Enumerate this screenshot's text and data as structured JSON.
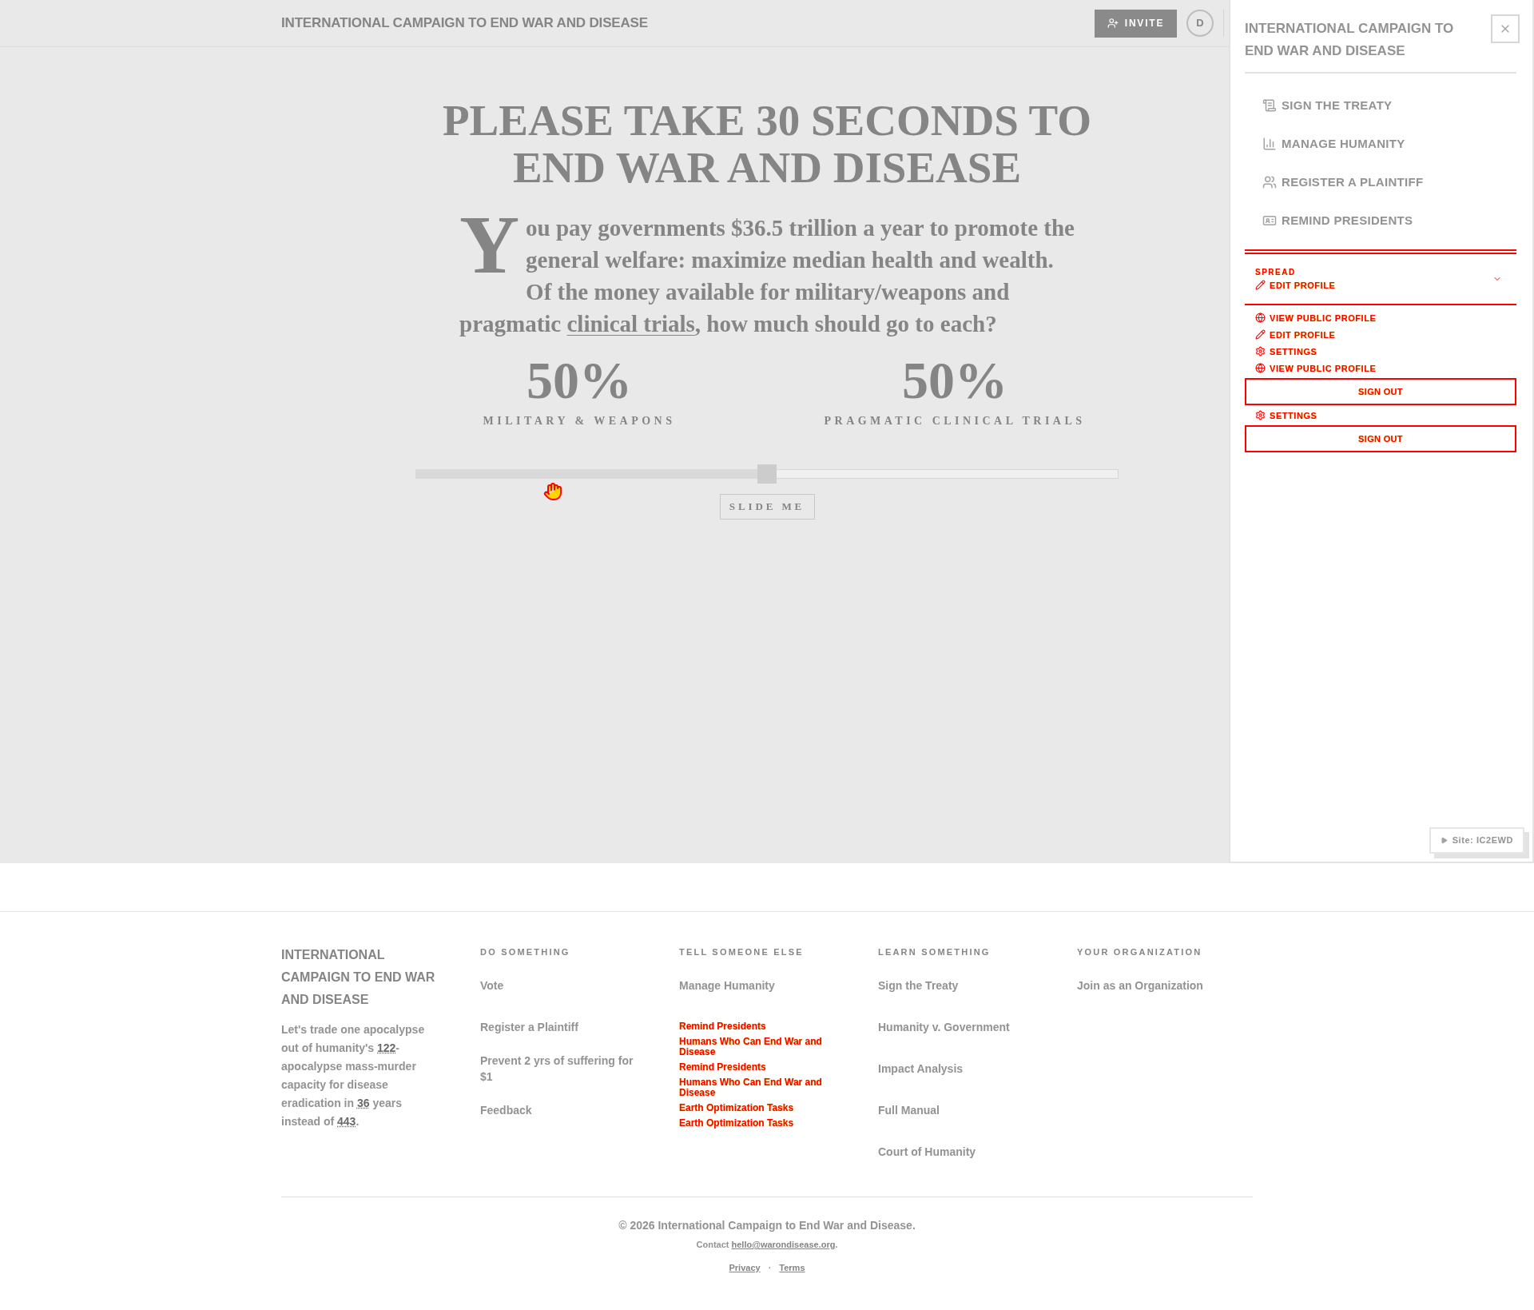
{
  "header": {
    "title": "INTERNATIONAL CAMPAIGN TO END WAR AND DISEASE",
    "invite_button": "INVITE",
    "avatar": "D"
  },
  "hero": {
    "title": "PLEASE TAKE 30 SECONDS TO END WAR AND DISEASE",
    "intro": {
      "drop_cap": "Y",
      "text": "ou pay governments $36.5 trillion a year to promote the general welfare: maximize median health and wealth. Of the money available for military/weapons and pragmatic ",
      "link": "clinical trials",
      "text_after": ", how much should go to each?"
    },
    "allocations": [
      {
        "percent": "50%",
        "label": "MILITARY & WEAPONS"
      },
      {
        "percent": "50%",
        "label": "PRAGMATIC CLINICAL TRIALS"
      }
    ],
    "slider": {
      "level": 0.5
    },
    "slide_button": "SLIDE ME"
  },
  "drawer": {
    "title": "INTERNATIONAL CAMPAIGN TO END WAR AND DISEASE",
    "nav": [
      {
        "label": "SIGN THE TREATY",
        "kind": "treaty"
      },
      {
        "label": "MANAGE HUMANITY",
        "kind": "manage"
      },
      {
        "label": "REGISTER A PLAINTIFF",
        "kind": "plaintiff"
      },
      {
        "label": "REMIND PRESIDENTS",
        "kind": "remind"
      }
    ],
    "account_menu": {
      "heading": "SPREAD",
      "expanded": true,
      "header_items": [
        {
          "kind": "edit",
          "label": "EDIT PROFILE"
        }
      ],
      "items": [
        {
          "kind": "view",
          "label": "VIEW PUBLIC PROFILE"
        },
        {
          "kind": "edit",
          "label": "EDIT PROFILE"
        },
        {
          "kind": "settings",
          "label": "SETTINGS"
        },
        {
          "kind": "view",
          "label": "VIEW PUBLIC PROFILE"
        },
        {
          "kind": "signout",
          "label": "SIGN OUT"
        },
        {
          "kind": "settings",
          "label": "SETTINGS"
        },
        {
          "kind": "signout",
          "label": "SIGN OUT"
        }
      ]
    },
    "site_badge": "Site: IC2EWD"
  },
  "footer": {
    "brand": "INTERNATIONAL CAMPAIGN TO END WAR AND DISEASE",
    "tagline": "Let's trade one apocalypse out of humanity's **122**-apocalypse mass-murder capacity for disease eradication in **36** years instead of **443**.",
    "columns": [
      {
        "heading": "DO SOMETHING",
        "links": [
          {
            "label": "Vote",
            "kind": "link"
          },
          {
            "label": "Register a Plaintiff",
            "kind": "link"
          },
          {
            "label": "Prevent 2 yrs of suffering for $1",
            "kind": "link"
          },
          {
            "label": "Feedback",
            "kind": "link"
          }
        ]
      },
      {
        "heading": "TELL SOMEONE ELSE",
        "links": [
          {
            "label": "Manage Humanity",
            "kind": "link"
          },
          {
            "label": "Remind Presidents",
            "kind": "flagged"
          },
          {
            "label": "Humans Who Can End War and Disease",
            "kind": "flagged"
          },
          {
            "label": "Remind Presidents",
            "kind": "flagged"
          },
          {
            "label": "Humans Who Can End War and Disease",
            "kind": "flagged"
          },
          {
            "label": "Earth Optimization Tasks",
            "kind": "flagged"
          },
          {
            "label": "Earth Optimization Tasks",
            "kind": "flagged"
          }
        ]
      },
      {
        "heading": "LEARN SOMETHING",
        "links": [
          {
            "label": "Sign the Treaty",
            "kind": "link"
          },
          {
            "label": "Humanity v. Government",
            "kind": "link"
          },
          {
            "label": "Impact Analysis",
            "kind": "link"
          },
          {
            "label": "Full Manual",
            "kind": "link"
          },
          {
            "label": "Court of Humanity",
            "kind": "link"
          }
        ]
      },
      {
        "heading": "YOUR ORGANIZATION",
        "links": [
          {
            "label": "Join as an Organization",
            "kind": "link"
          }
        ]
      }
    ],
    "copyright": "© 2026 International Campaign to End War and Disease.",
    "contact": {
      "text": "Contact ",
      "email": "hello@warondisease.org",
      "end": "."
    },
    "legal": [
      "Privacy",
      "Terms"
    ],
    "separator": "·"
  }
}
